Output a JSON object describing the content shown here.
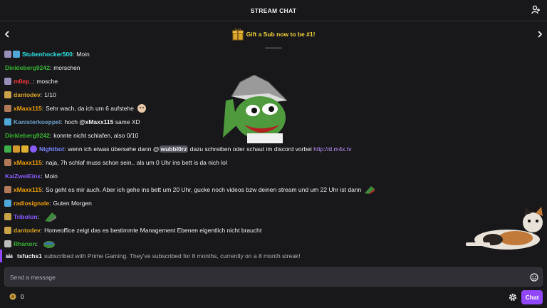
{
  "header": {
    "title": "STREAM CHAT",
    "user_list_icon": "users-icon"
  },
  "gift_bar": {
    "text": "Gift a Sub now to be #1!",
    "icon": "gift-icon",
    "prev_icon": "chevron-left-icon",
    "next_icon": "chevron-right-icon"
  },
  "messages": [
    {
      "user": "Stubenhocker500",
      "color": "#2ee6e6",
      "text": "Moin"
    },
    {
      "user": "Dinkleberg9242",
      "color": "#36b52f",
      "text": "morschen"
    },
    {
      "user": "m0ep_",
      "color": "#ff3b3b",
      "text": "mosche"
    },
    {
      "user": "dantodev",
      "color": "#daa520",
      "text": "1/10"
    },
    {
      "user": "xMaxx115",
      "color": "#f0a000",
      "text": "Sehr wach, da ich um 6 aufstehe"
    },
    {
      "user": "Kanisterkoeppel",
      "color": "#6fa0c8",
      "text_before": "hoch",
      "mention": "@xMaxx115",
      "text_after": "same XD"
    },
    {
      "user": "Dinkleberg9242",
      "color": "#36b52f",
      "text": "konnte nicht schlafen, also 0/10"
    },
    {
      "user": "Nightbot",
      "color": "#7a85ff",
      "text_before": "wenn ich etwas übersehe dann @",
      "mention": "wubbl0rz",
      "text_after": "dazu schreiben oder schaut im discord vorbei",
      "link": "http://d.m4x.tv"
    },
    {
      "user": "xMaxx115",
      "color": "#f0a000",
      "text": "naja, 7h schlaf muss schon sein.. als um 0 Uhr ins bett is da nich lol"
    },
    {
      "user": "KaiZweiEins",
      "color": "#8a5cff",
      "text": "Moin"
    },
    {
      "user": "xMaxx115",
      "color": "#f0a000",
      "text": "So geht es mir auch. Aber ich gehe ins bett um 20 Uhr, gucke noch videos bzw deinen stream und um 22 Uhr ist dann"
    },
    {
      "user": "radiosignale",
      "color": "#f0a000",
      "text": "Guten Morgen"
    },
    {
      "user": "Tribolon",
      "color": "#8a5cff",
      "text": ""
    },
    {
      "user": "dantodev",
      "color": "#daa520",
      "text": "Homeoffice zeigt das es bestimmte Management Ebenen eigentlich nicht braucht"
    },
    {
      "user": "Rhanon",
      "color": "#36b52f",
      "text": ""
    }
  ],
  "sub_notice": {
    "user": "tsfuchs1",
    "text": "subscribed with Prime Gaming. They've subscribed for 8 months, currently on a 8 month streak!"
  },
  "input": {
    "placeholder": "Send a message",
    "value": ""
  },
  "bottom": {
    "points": "0",
    "chat_button": "Chat",
    "settings_icon": "gear-icon"
  },
  "colors": {
    "accent": "#9147ff",
    "background": "#18181b",
    "gift_text": "#f5d53a"
  }
}
